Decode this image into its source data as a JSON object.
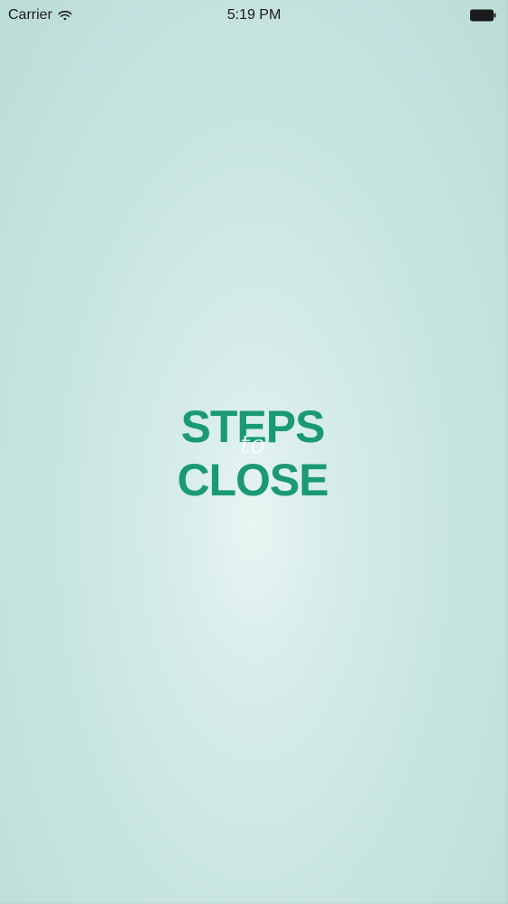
{
  "status_bar": {
    "carrier": "Carrier",
    "time": "5:19 PM",
    "wifi_icon": "wifi-icon",
    "battery_icon": "battery-icon"
  },
  "splash": {
    "logo_top": "STEPS",
    "logo_middle": "to",
    "logo_bottom": "CLOSE"
  },
  "colors": {
    "background": "#cfe7e4",
    "logo_green": "#1a9a72",
    "logo_white": "#ffffff"
  }
}
